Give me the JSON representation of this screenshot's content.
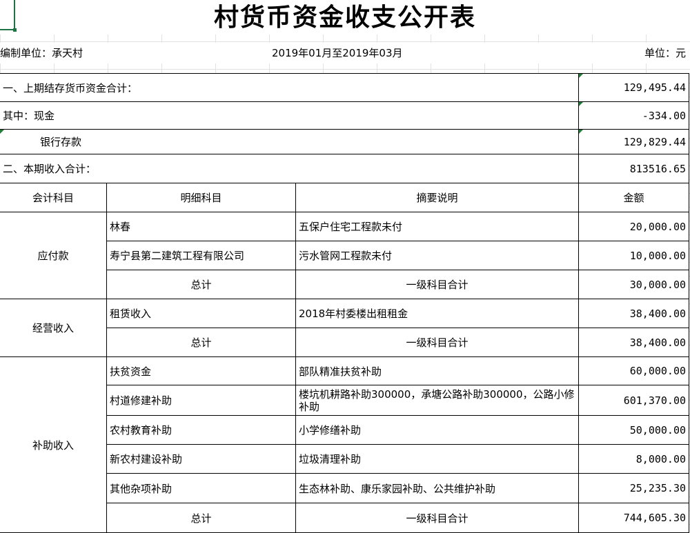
{
  "title": "村货币资金收支公开表",
  "header": {
    "unit_label": "编制单位：承天村",
    "period": "2019年01月至2019年03月",
    "currency_label": "单位：元"
  },
  "summary": [
    {
      "label": "一、上期结存货币资金合计：",
      "value": "129,495.44",
      "indent": false
    },
    {
      "label": "其中：现金",
      "value": "-334.00",
      "indent": false
    },
    {
      "label": "银行存款",
      "value": "129,829.44",
      "indent": true
    },
    {
      "label": "二、本期收入合计：",
      "value": "813516.65",
      "indent": false
    }
  ],
  "columns": [
    "会计科目",
    "明细科目",
    "摘要说明",
    "金额"
  ],
  "groups": [
    {
      "account": "应付款",
      "rows": [
        {
          "detail": "林春",
          "desc": "五保户住宅工程款未付",
          "amount": "20,000.00"
        },
        {
          "detail": "寿宁县第二建筑工程有限公司",
          "desc": "污水管网工程款未付",
          "amount": "10,000.00"
        }
      ],
      "total": {
        "detail": "总计",
        "desc": "一级科目合计",
        "amount": "30,000.00"
      }
    },
    {
      "account": "经营收入",
      "rows": [
        {
          "detail": "租赁收入",
          "desc": "2018年村委楼出租租金",
          "amount": "38,400.00"
        }
      ],
      "total": {
        "detail": "总计",
        "desc": "一级科目合计",
        "amount": "38,400.00"
      }
    },
    {
      "account": "补助收入",
      "rows": [
        {
          "detail": "扶贫资金",
          "desc": "部队精准扶贫补助",
          "amount": "60,000.00"
        },
        {
          "detail": "村道修建补助",
          "desc": "楼坑机耕路补助300000，承塘公路补助300000，公路小修补助",
          "amount": "601,370.00"
        },
        {
          "detail": "农村教育补助",
          "desc": "小学修缮补助",
          "amount": "50,000.00"
        },
        {
          "detail": "新农村建设补助",
          "desc": "垃圾清理补助",
          "amount": "8,000.00"
        },
        {
          "detail": "其他杂项补助",
          "desc": "生态林补助、康乐家园补助、公共维护补助",
          "amount": "25,235.30"
        }
      ],
      "total": {
        "detail": "总计",
        "desc": "一级科目合计",
        "amount": "744,605.30"
      }
    }
  ]
}
